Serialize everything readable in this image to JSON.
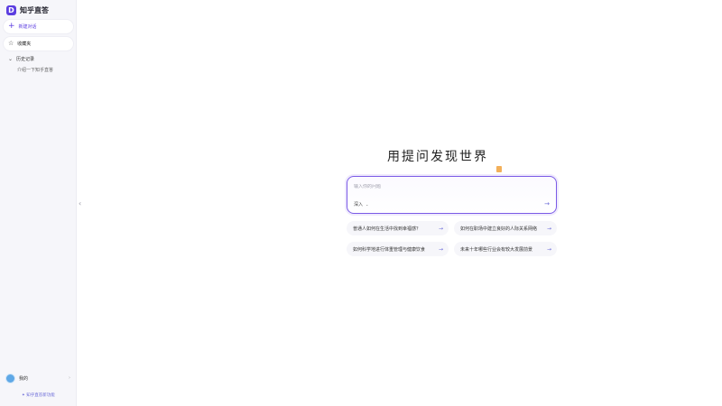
{
  "app": {
    "name": "知乎直答",
    "logo_letter": "D",
    "accent": "#5b3de0"
  },
  "sidebar": {
    "new_chat_label": "新建对话",
    "favorites_label": "收藏夹",
    "history_label": "历史记录",
    "history_items": [
      "介绍一下知乎直答"
    ],
    "user_name": "我的",
    "more_label": "›",
    "footer_note": "✦ 知乎直答新功能"
  },
  "main": {
    "title": "用提问发现世界",
    "input_placeholder": "输入你的问题",
    "mode_label": "深入",
    "mode_caret": "⌄",
    "send_icon": "→",
    "suggestions": [
      {
        "text": "普通人如何在生活中找到幸福感？",
        "arrow": "→"
      },
      {
        "text": "如何在职场中建立良好的人际关系网络",
        "arrow": "→"
      },
      {
        "text": "如何科学地进行体重管理与健康饮食",
        "arrow": "→"
      },
      {
        "text": "未来十年哪些行业会有较大发展前景",
        "arrow": "→"
      }
    ]
  },
  "collapse_icon": "‹"
}
